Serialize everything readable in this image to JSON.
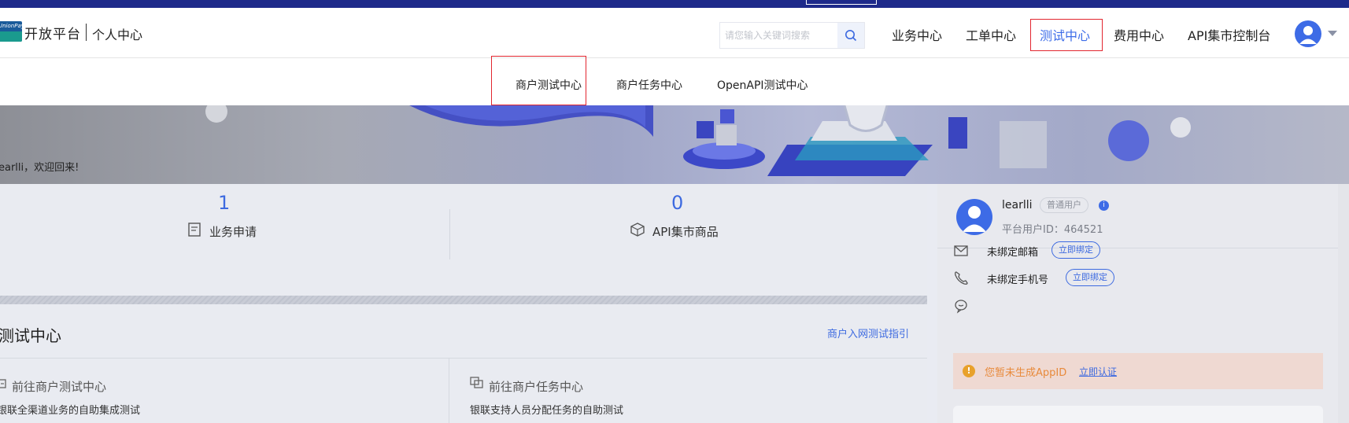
{
  "header": {
    "brand_mark": "UnionPay",
    "brand": "开放平台",
    "brand_sub": "个人中心",
    "search_placeholder": "请您输入关键词搜索",
    "nav": [
      "业务中心",
      "工单中心",
      "测试中心",
      "费用中心",
      "API集市控制台"
    ],
    "active_nav": "测试中心"
  },
  "subnav": {
    "items": [
      "商户测试中心",
      "商户任务中心",
      "OpenAPI测试中心"
    ],
    "active_item": "商户测试中心"
  },
  "banner": {
    "welcome": "earlli，欢迎回来!"
  },
  "stats": [
    {
      "value": "1",
      "label": "业务申请"
    },
    {
      "value": "0",
      "label": "API集市商品"
    }
  ],
  "test_center": {
    "title": "测试中心",
    "guide_link": "商户入网测试指引",
    "cards": [
      {
        "title": "前往商户测试中心",
        "desc": "银联全渠道业务的自助集成测试"
      },
      {
        "title": "前往商户任务中心",
        "desc": "银联支持人员分配任务的自助测试"
      }
    ]
  },
  "profile": {
    "username": "learlli",
    "role_badge": "普通用户",
    "user_id": "平台用户ID：464521",
    "email_label": "未绑定邮箱",
    "email_btn": "立即绑定",
    "phone_label": "未绑定手机号",
    "phone_btn": "立即绑定",
    "alert_text": "您暂未生成AppID",
    "alert_link": "立即认证"
  },
  "colors": {
    "accent": "#3d6ae0",
    "highlight_box": "#e2262f",
    "top_strip": "#1e2a8a",
    "alert_bg": "#efd9d2",
    "alert_text": "#e88a3b"
  },
  "icons": [
    "search-icon",
    "user-avatar-icon",
    "chevron-down-icon",
    "document-icon",
    "box-icon",
    "switch-icon",
    "copy-icon",
    "mail-icon",
    "phone-icon",
    "chat-icon",
    "warning-icon",
    "info-icon"
  ]
}
